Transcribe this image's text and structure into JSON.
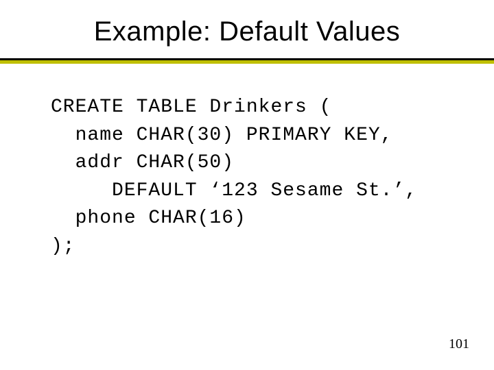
{
  "title": "Example: Default Values",
  "code": {
    "l1": "CREATE TABLE Drinkers (",
    "l2": "  name CHAR(30) PRIMARY KEY,",
    "l3": "  addr CHAR(50)",
    "l4": "     DEFAULT ‘123 Sesame St.’,",
    "l5": "  phone CHAR(16)",
    "l6": ");"
  },
  "page_number": "101"
}
